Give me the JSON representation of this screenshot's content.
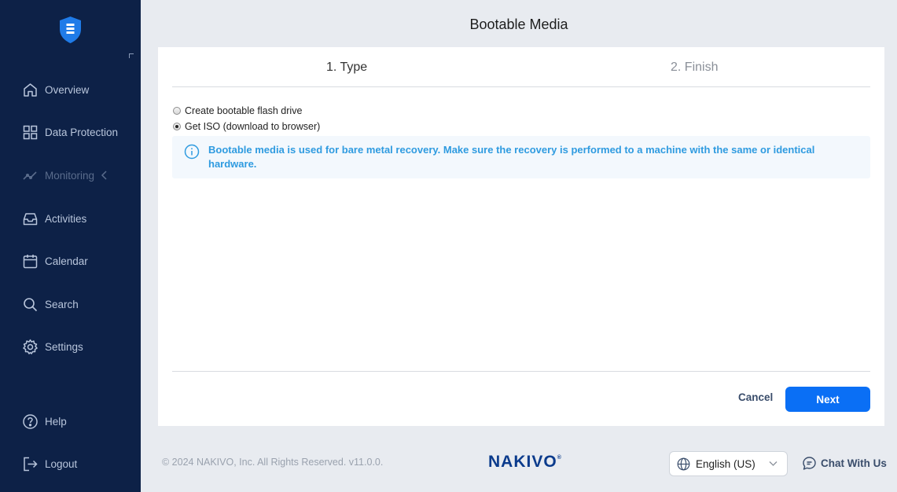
{
  "header": {
    "title": "Bootable Media"
  },
  "sidebar": {
    "items": [
      {
        "id": "overview",
        "label": "Overview",
        "icon": "home-icon"
      },
      {
        "id": "data-protection",
        "label": "Data Protection",
        "icon": "grid-icon"
      },
      {
        "id": "monitoring",
        "label": "Monitoring",
        "icon": "chart-line-icon",
        "disabled": true
      },
      {
        "id": "activities",
        "label": "Activities",
        "icon": "inbox-icon"
      },
      {
        "id": "calendar",
        "label": "Calendar",
        "icon": "calendar-icon"
      },
      {
        "id": "search",
        "label": "Search",
        "icon": "search-icon"
      },
      {
        "id": "settings",
        "label": "Settings",
        "icon": "gear-icon"
      }
    ],
    "bottom": [
      {
        "id": "help",
        "label": "Help",
        "icon": "help-icon"
      },
      {
        "id": "logout",
        "label": "Logout",
        "icon": "logout-icon"
      }
    ]
  },
  "wizard": {
    "steps": [
      {
        "label": "1. Type",
        "active": true
      },
      {
        "label": "2. Finish",
        "active": false
      }
    ],
    "options": [
      {
        "label": "Create bootable flash drive",
        "checked": false
      },
      {
        "label": "Get ISO (download to browser)",
        "checked": true
      }
    ],
    "info": "Bootable media is used for bare metal recovery. Make sure the recovery is performed to a machine with the same or identical hardware.",
    "cancel_label": "Cancel",
    "next_label": "Next"
  },
  "footer": {
    "copyright": "© 2024 NAKIVO, Inc. All Rights Reserved. v11.0.0.",
    "brand": "NAKIVO",
    "brand_mark": "®",
    "language": "English (US)",
    "chat_label": "Chat With Us"
  },
  "colors": {
    "sidebar_bg": "#0d2147",
    "accent": "#0a6ff5",
    "info_text": "#2f9be0",
    "brand": "#0b3b8c"
  }
}
